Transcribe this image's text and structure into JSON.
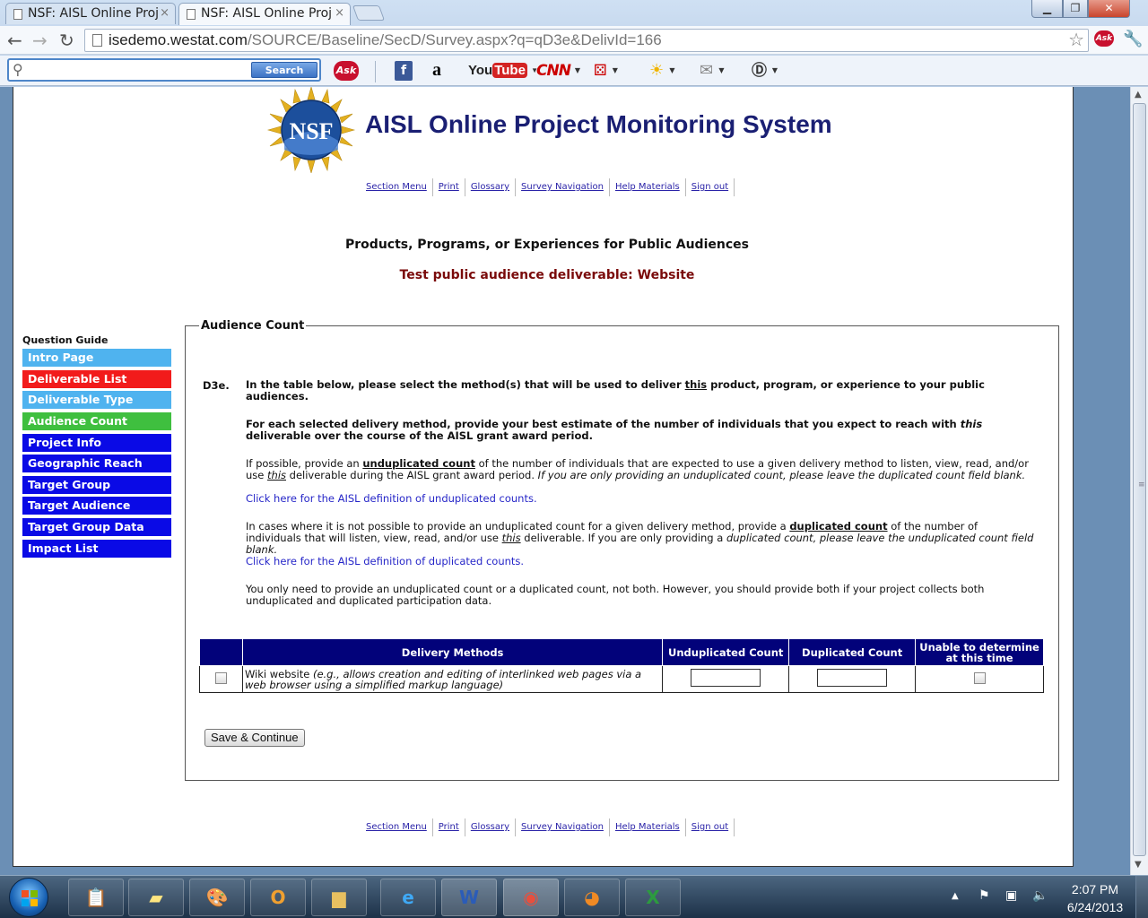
{
  "browser": {
    "tabs": [
      {
        "label": "NSF: AISL Online Proj"
      },
      {
        "label": "NSF: AISL Online Proj"
      }
    ],
    "url_host": "isedemo.westat.com",
    "url_path": "/SOURCE/Baseline/SecD/Survey.aspx?q=qD3e&DelivId=166",
    "toolbar": {
      "search_button": "Search",
      "search_value": "",
      "ask_label": "Ask",
      "facebook_label": "f",
      "amazon_label": "a",
      "youtube_you": "You",
      "youtube_tube": "Tube",
      "cnn_label": "CNN"
    }
  },
  "site": {
    "logo_text": "NSF",
    "title": "AISL Online Project Monitoring System",
    "links": [
      "Section Menu",
      "Print",
      "Glossary",
      "Survey Navigation",
      "Help Materials",
      "Sign out"
    ]
  },
  "section_title": "Products, Programs, or Experiences for Public Audiences",
  "deliverable_title": "Test public audience deliverable: Website",
  "guide": {
    "title": "Question Guide",
    "items": [
      {
        "label": "Intro Page",
        "color": "#4fb3ef"
      },
      {
        "label": "Deliverable List",
        "color": "#f21b1b"
      },
      {
        "label": "Deliverable Type",
        "color": "#4fb3ef"
      },
      {
        "label": "Audience Count",
        "color": "#3fbf3f"
      },
      {
        "label": "Project Info",
        "color": "#0a0ae6"
      },
      {
        "label": "Geographic Reach",
        "color": "#0a0ae6"
      },
      {
        "label": "Target Group",
        "color": "#0a0ae6"
      },
      {
        "label": "Target Audience",
        "color": "#0a0ae6"
      },
      {
        "label": "Target Group Data",
        "color": "#0a0ae6"
      },
      {
        "label": "Impact List",
        "color": "#0a0ae6"
      }
    ]
  },
  "form": {
    "legend": "Audience Count",
    "qnum": "D3e.",
    "q1a": "In the table below, please select the method(s) that will be used to deliver ",
    "q1b": "this",
    "q1c": " product, program, or experience to your public audiences.",
    "q2a": "For each selected delivery method, provide your best estimate of the number of individuals that you expect to reach with ",
    "q2b": "this",
    "q2c": " deliverable over the course of the AISL grant award period.",
    "q3a": "If possible, provide an ",
    "q3b": "unduplicated count",
    "q3c": " of the number of individuals that are expected to use a given delivery method to listen, view, read, and/or use ",
    "q3d": "this",
    "q3e": " deliverable during the AISL grant award period. ",
    "q3f": "If you are only providing an unduplicated count, please leave the duplicated count field blank.",
    "link_unduplicated": "Click here for the AISL definition of unduplicated counts.",
    "q5a": "In cases where it is not possible to provide an unduplicated count for a given delivery method, provide a ",
    "q5b": "duplicated count",
    "q5c": " of the number of individuals that will listen, view, read, and/or use ",
    "q5d": "this",
    "q5e": " deliverable. If you are only providing a ",
    "q5f": "duplicated count, please leave the unduplicated count field blank.",
    "link_duplicated": "Click here for the AISL definition of duplicated counts.",
    "q7": "You only need to provide an unduplicated count or a duplicated count, not both. However, you should provide both if your project collects both unduplicated and duplicated participation data.",
    "table": {
      "headers": [
        "Delivery Methods",
        "Unduplicated Count",
        "Duplicated Count",
        "Unable to determine at this time"
      ],
      "rows": [
        {
          "method": "Wiki website ",
          "method_note": "(e.g., allows creation and editing of interlinked web pages via a web browser using a simplified markup language)",
          "unduplicated": "",
          "duplicated": ""
        }
      ]
    },
    "save_button": "Save & Continue"
  },
  "taskbar": {
    "apps": [
      "notepad-icon",
      "sticky-notes-icon",
      "paint-icon",
      "outlook-icon",
      "folder-icon",
      "ie-icon",
      "word-icon",
      "chrome-icon",
      "firefox-icon",
      "excel-icon"
    ],
    "time": "2:07 PM",
    "date": "6/24/2013"
  }
}
